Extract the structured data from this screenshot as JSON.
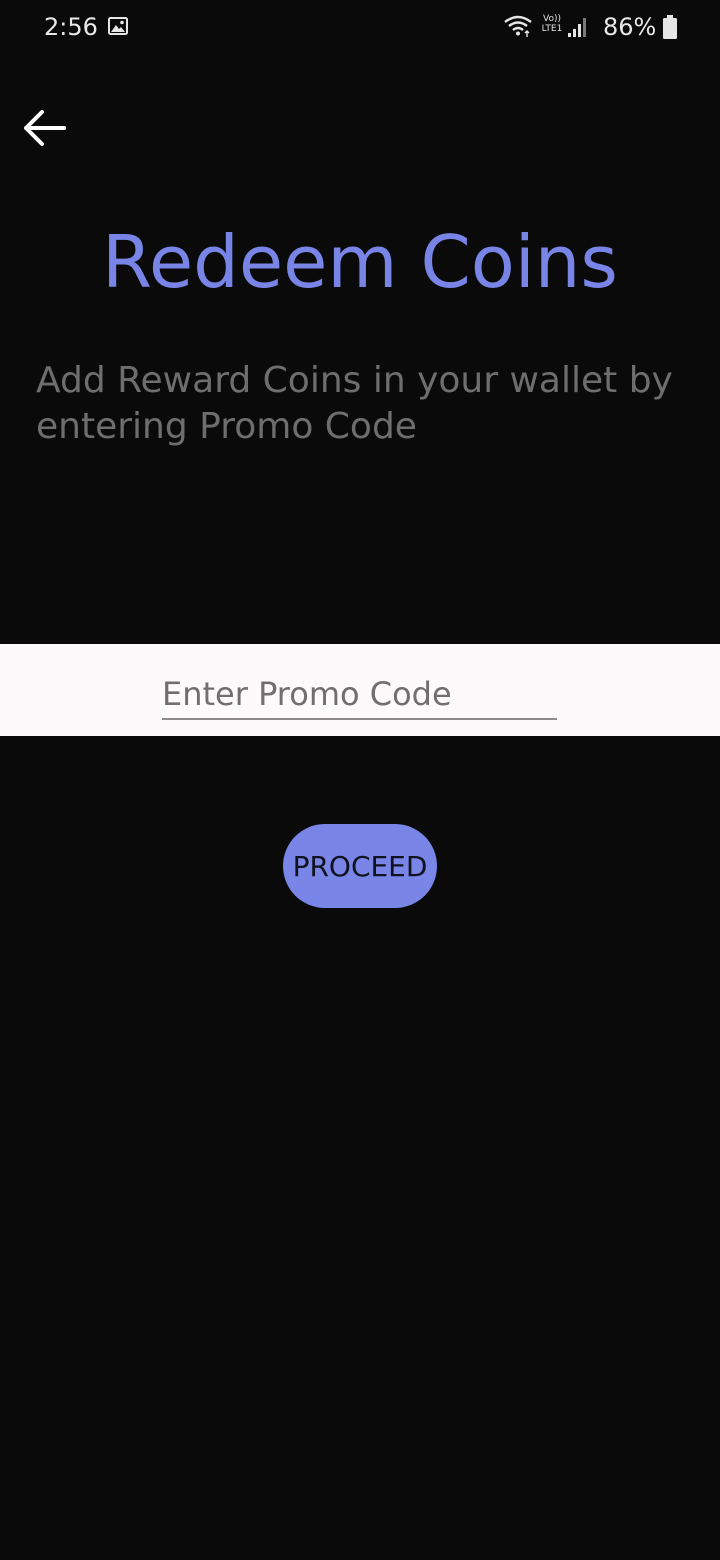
{
  "status_bar": {
    "time": "2:56",
    "battery": "86%",
    "volte_top": "Vo))",
    "volte_bottom": "LTE1",
    "icons": [
      "gallery-icon",
      "wifi-icon",
      "volte-icon",
      "signal-icon",
      "battery-icon"
    ]
  },
  "header": {
    "back_icon": "arrow-left-icon"
  },
  "main": {
    "title": "Redeem Coins",
    "subtitle": "Add Reward Coins in your wallet by entering Promo Code",
    "promo_placeholder": "Enter Promo Code",
    "promo_value": "",
    "proceed_label": "PROCEED"
  },
  "colors": {
    "background": "#0a0a0b",
    "accent": "#7885e6",
    "subtitle": "#6e6e6e",
    "input_band": "#fcfafa"
  }
}
